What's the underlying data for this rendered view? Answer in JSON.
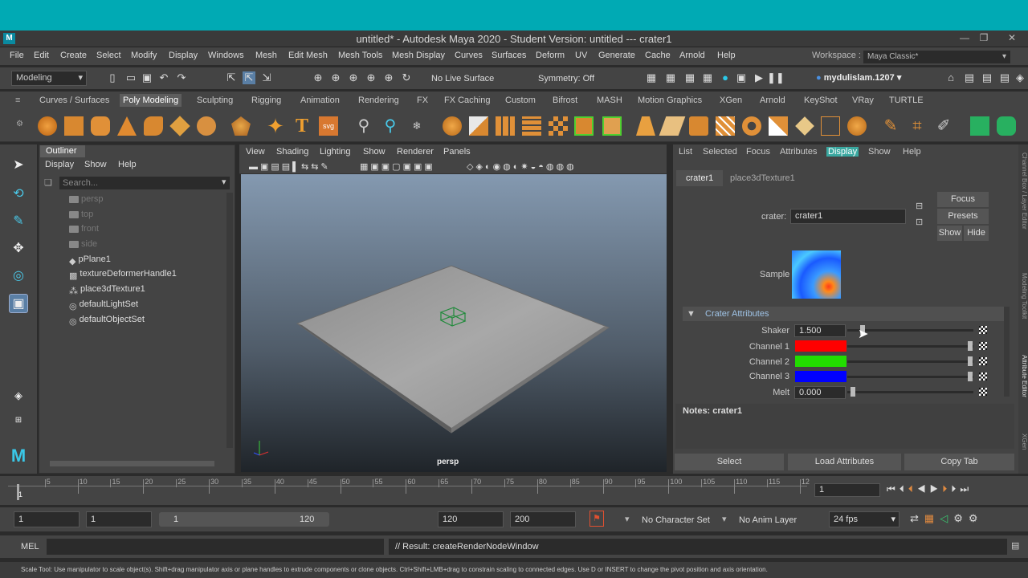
{
  "window": {
    "title": "untitled* - Autodesk Maya 2020 - Student Version: untitled   ---   crater1",
    "logo": "M"
  },
  "menubar": {
    "items": [
      "File",
      "Edit",
      "Create",
      "Select",
      "Modify",
      "Display",
      "Windows",
      "Mesh",
      "Edit Mesh",
      "Mesh Tools",
      "Mesh Display",
      "Curves",
      "Surfaces",
      "Deform",
      "UV",
      "Generate",
      "Cache",
      "Arnold",
      "Help"
    ],
    "workspace_label": "Workspace :",
    "workspace_value": "Maya Classic*"
  },
  "statusline": {
    "mode": "Modeling",
    "live_surface": "No Live Surface",
    "symmetry": "Symmetry: Off",
    "user": "mydulislam.1207"
  },
  "shelf": {
    "tabs": [
      "Curves / Surfaces",
      "Poly Modeling",
      "Sculpting",
      "Rigging",
      "Animation",
      "Rendering",
      "FX",
      "FX Caching",
      "Custom",
      "Bifrost",
      "MASH",
      "Motion Graphics",
      "XGen",
      "Arnold",
      "KeyShot",
      "VRay",
      "TURTLE"
    ],
    "active_tab": "Poly Modeling"
  },
  "outliner": {
    "title": "Outliner",
    "menu": [
      "Display",
      "Show",
      "Help"
    ],
    "search_placeholder": "Search...",
    "items": [
      {
        "label": "persp",
        "icon": "camera-icon",
        "dim": true
      },
      {
        "label": "top",
        "icon": "camera-icon",
        "dim": true
      },
      {
        "label": "front",
        "icon": "camera-icon",
        "dim": true
      },
      {
        "label": "side",
        "icon": "camera-icon",
        "dim": true
      },
      {
        "label": "pPlane1",
        "icon": "mesh-icon",
        "dim": false
      },
      {
        "label": "textureDeformerHandle1",
        "icon": "deformer-icon",
        "dim": false
      },
      {
        "label": "place3dTexture1",
        "icon": "texture-icon",
        "dim": false
      },
      {
        "label": "defaultLightSet",
        "icon": "set-icon",
        "dim": false
      },
      {
        "label": "defaultObjectSet",
        "icon": "set-icon",
        "dim": false
      }
    ]
  },
  "viewport": {
    "menu": [
      "View",
      "Shading",
      "Lighting",
      "Show",
      "Renderer",
      "Panels"
    ],
    "camera_label": "persp"
  },
  "attribute_editor": {
    "menu": [
      "List",
      "Selected",
      "Focus",
      "Attributes",
      "Display",
      "Show",
      "Help"
    ],
    "highlighted_menu": "Display",
    "tabs": [
      "crater1",
      "place3dTexture1"
    ],
    "node_type_label": "crater:",
    "node_name": "crater1",
    "buttons": {
      "focus": "Focus",
      "presets": "Presets",
      "show": "Show",
      "hide": "Hide"
    },
    "sample_label": "Sample",
    "section_title": "Crater Attributes",
    "attrs": [
      {
        "label": "Shaker",
        "value": "1.500",
        "type": "float",
        "slider_fraction": 0.1
      },
      {
        "label": "Channel 1",
        "color": "#ff0000",
        "type": "color"
      },
      {
        "label": "Channel 2",
        "color": "#22dd00",
        "type": "color"
      },
      {
        "label": "Channel 3",
        "color": "#0000ff",
        "type": "color"
      },
      {
        "label": "Melt",
        "value": "0.000",
        "type": "float",
        "slider_fraction": 0.0
      }
    ],
    "notes_label": "Notes:  crater1",
    "bottom_buttons": [
      "Select",
      "Load Attributes",
      "Copy Tab"
    ]
  },
  "right_tabs": [
    "Channel Box / Layer Editor",
    "Modeling Toolkit",
    "Attribute Editor",
    "XGen"
  ],
  "timeline": {
    "ticks": [
      "5",
      "10",
      "15",
      "20",
      "25",
      "30",
      "35",
      "40",
      "45",
      "50",
      "55",
      "60",
      "65",
      "70",
      "75",
      "80",
      "85",
      "90",
      "95",
      "100",
      "105",
      "110",
      "115",
      "12"
    ],
    "first_tick": "1",
    "current_frame": "1"
  },
  "range": {
    "start": "1",
    "playback_start": "1",
    "slider_start": "1",
    "slider_end": "120",
    "playback_end": "120",
    "end": "200",
    "character_set": "No Character Set",
    "anim_layer": "No Anim Layer",
    "fps": "24 fps"
  },
  "cmdline": {
    "lang": "MEL",
    "result": "// Result: createRenderNodeWindow"
  },
  "helpline": "Scale Tool: Use manipulator to scale object(s). Shift+drag manipulator axis or plane handles to extrude components or clone objects. Ctrl+Shift+LMB+drag to constrain scaling to connected edges. Use D or INSERT to change the pivot position and axis orientation."
}
